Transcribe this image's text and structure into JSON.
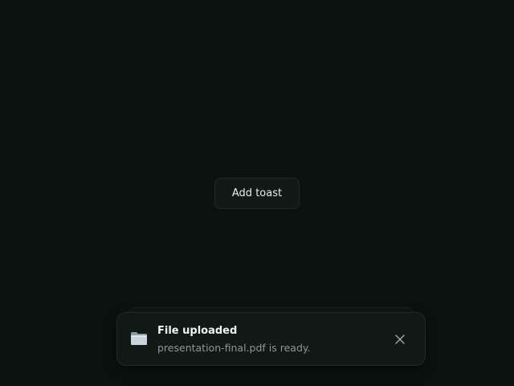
{
  "main": {
    "add_toast_label": "Add toast"
  },
  "toast": {
    "icon": "folder-icon",
    "title": "File uploaded",
    "description": "presentation-final.pdf is ready.",
    "close_icon": "close-icon"
  },
  "colors": {
    "background": "#0b1210",
    "surface": "#111917",
    "border": "#1f2927",
    "text_primary": "#eef2f0",
    "text_secondary": "#8d9794"
  }
}
